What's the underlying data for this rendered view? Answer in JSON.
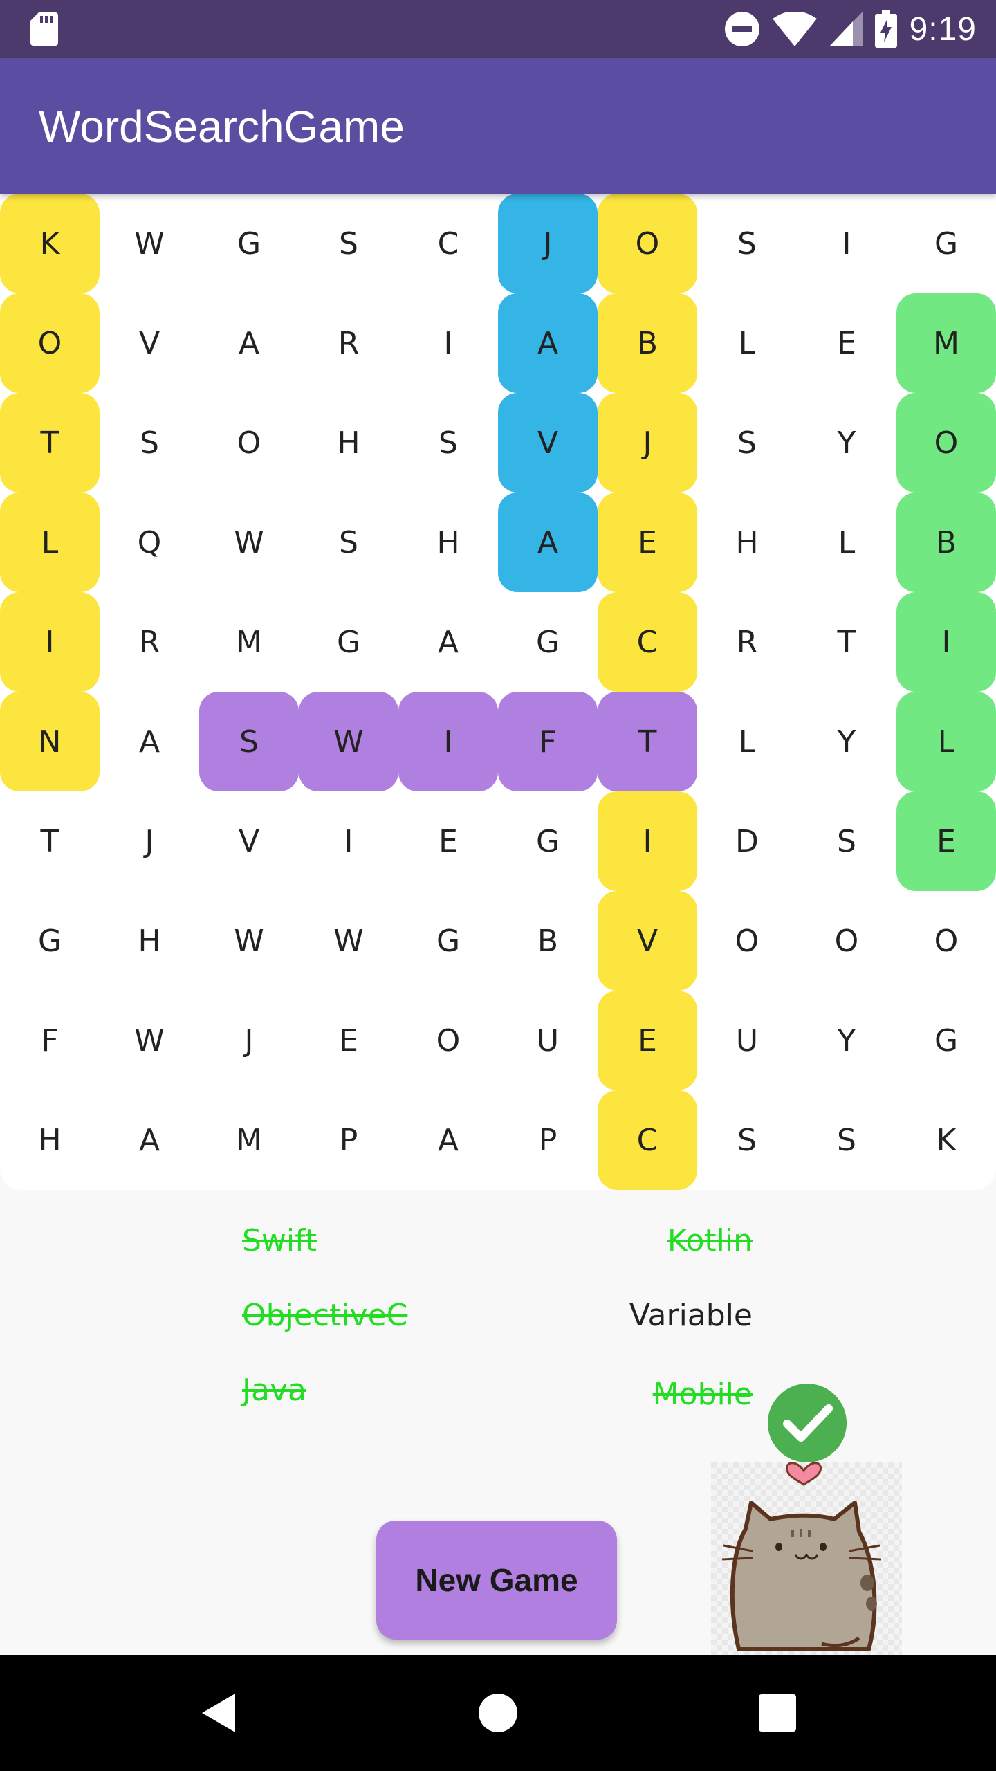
{
  "status_bar": {
    "time": "9:19",
    "icons": [
      "sd-card-icon",
      "do-not-disturb-icon",
      "wifi-icon",
      "signal-icon",
      "battery-charging-icon"
    ]
  },
  "app_bar": {
    "title": "WordSearchGame"
  },
  "grid": {
    "rows": [
      [
        "K",
        "W",
        "G",
        "S",
        "C",
        "J",
        "O",
        "S",
        "I",
        "G"
      ],
      [
        "O",
        "V",
        "A",
        "R",
        "I",
        "A",
        "B",
        "L",
        "E",
        "M"
      ],
      [
        "T",
        "S",
        "O",
        "H",
        "S",
        "V",
        "J",
        "S",
        "Y",
        "O"
      ],
      [
        "L",
        "Q",
        "W",
        "S",
        "H",
        "A",
        "E",
        "H",
        "L",
        "B"
      ],
      [
        "I",
        "R",
        "M",
        "G",
        "A",
        "G",
        "C",
        "R",
        "T",
        "I"
      ],
      [
        "N",
        "A",
        "S",
        "W",
        "I",
        "F",
        "T",
        "L",
        "Y",
        "L"
      ],
      [
        "T",
        "J",
        "V",
        "I",
        "E",
        "G",
        "I",
        "D",
        "S",
        "E"
      ],
      [
        "G",
        "H",
        "W",
        "W",
        "G",
        "B",
        "V",
        "O",
        "O",
        "O"
      ],
      [
        "F",
        "W",
        "J",
        "E",
        "O",
        "U",
        "E",
        "U",
        "Y",
        "G"
      ],
      [
        "H",
        "A",
        "M",
        "P",
        "A",
        "P",
        "C",
        "S",
        "S",
        "K"
      ]
    ],
    "highlights": [
      {
        "word": "Kotlin",
        "color": "#fde540",
        "cells": [
          [
            0,
            0
          ],
          [
            1,
            0
          ],
          [
            2,
            0
          ],
          [
            3,
            0
          ],
          [
            4,
            0
          ],
          [
            5,
            0
          ]
        ]
      },
      {
        "word": "Java",
        "color": "#35b5e5",
        "cells": [
          [
            0,
            5
          ],
          [
            1,
            5
          ],
          [
            2,
            5
          ],
          [
            3,
            5
          ]
        ]
      },
      {
        "word": "ObjectiveC",
        "color": "#fde540",
        "cells": [
          [
            0,
            6
          ],
          [
            1,
            6
          ],
          [
            2,
            6
          ],
          [
            3,
            6
          ],
          [
            4,
            6
          ],
          [
            5,
            6
          ],
          [
            6,
            6
          ],
          [
            7,
            6
          ],
          [
            8,
            6
          ],
          [
            9,
            6
          ]
        ]
      },
      {
        "word": "Mobile",
        "color": "#72e882",
        "cells": [
          [
            1,
            9
          ],
          [
            2,
            9
          ],
          [
            3,
            9
          ],
          [
            4,
            9
          ],
          [
            5,
            9
          ],
          [
            6,
            9
          ]
        ]
      },
      {
        "word": "Swift",
        "color": "#b080e0",
        "cells": [
          [
            5,
            2
          ],
          [
            5,
            3
          ],
          [
            5,
            4
          ],
          [
            5,
            5
          ],
          [
            5,
            6
          ]
        ]
      }
    ]
  },
  "word_list": [
    {
      "label": "Swift",
      "found": true
    },
    {
      "label": "Kotlin",
      "found": true
    },
    {
      "label": "ObjectiveC",
      "found": true
    },
    {
      "label": "Variable",
      "found": false
    },
    {
      "label": "Java",
      "found": true
    },
    {
      "label": "Mobile",
      "found": true
    }
  ],
  "new_game_button": {
    "label": "New Game"
  },
  "colors": {
    "status_bar": "#4b3a6b",
    "app_bar": "#5b4da2",
    "found_word": "#22dd22",
    "button": "#b07fe0",
    "check": "#4cb050"
  },
  "nav_bar": {
    "icons": [
      "back-icon",
      "home-icon",
      "recents-icon"
    ]
  }
}
